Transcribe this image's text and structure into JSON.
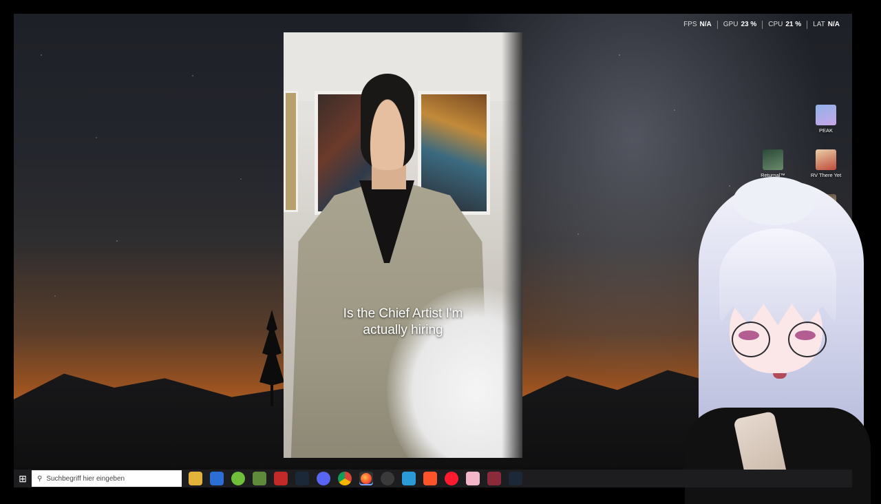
{
  "perf": {
    "fps_label": "FPS",
    "fps_value": "N/A",
    "gpu_label": "GPU",
    "gpu_value": "23 %",
    "cpu_label": "CPU",
    "cpu_value": "21 %",
    "lat_label": "LAT",
    "lat_value": "N/A"
  },
  "video": {
    "caption_line1": "Is the Chief Artist I'm",
    "caption_line2": "actually hiring"
  },
  "desktop_icons": {
    "peak": "PEAK",
    "returnal": "Returnal™",
    "rv": "RV There Yet"
  },
  "taskbar": {
    "search_placeholder": "Suchbegriff hier eingeben",
    "apps": [
      "file-explorer",
      "store",
      "green-app",
      "minecraft",
      "red-app",
      "steam",
      "discord",
      "chrome",
      "firefox",
      "obs",
      "blue-app",
      "brave",
      "opera",
      "pink-app",
      "red-app-2",
      "steam-2"
    ]
  }
}
